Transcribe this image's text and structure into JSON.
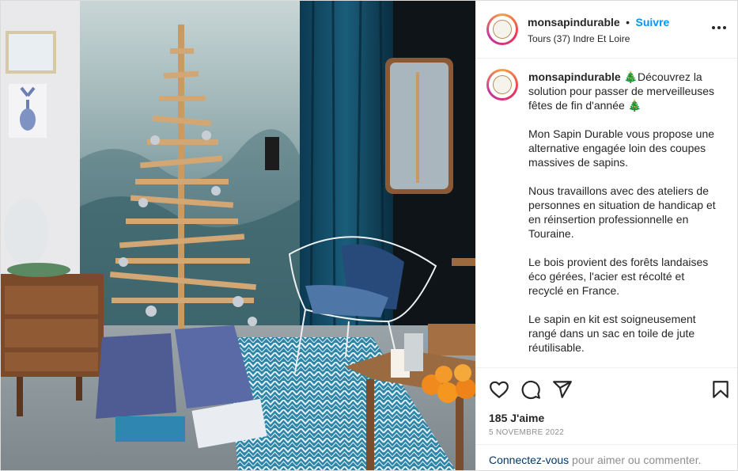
{
  "post": {
    "username": "monsapindurable",
    "separator": "•",
    "follow_label": "Suivre",
    "location": "Tours (37) Indre Et Loire",
    "more_label": "•••",
    "avatar_logo_text": "MON SAPIN DURABLE"
  },
  "caption": {
    "username": "monsapindurable",
    "paragraphs": [
      "🎄Découvrez la solution pour passer de merveilleuses fêtes de fin d'année 🎄",
      "Mon Sapin Durable vous propose une alternative engagée loin des coupes massives de sapins.",
      "Nous travaillons avec des ateliers de personnes en situation de handicap et en réinsertion professionnelle en Touraine.",
      "Le bois provient des forêts landaises éco gérées, l'acier est récolté et recyclé en France.",
      "Le sapin en kit est soigneusement rangé dans un sac en toile de jute réutilisable."
    ]
  },
  "actions": {
    "icons": [
      "heart-icon",
      "comment-icon",
      "share-icon",
      "bookmark-icon"
    ],
    "likes": "185 J'aime",
    "date": "5 NOVEMBRE 2022"
  },
  "login": {
    "link": "Connectez-vous",
    "text": " pour aimer ou commenter."
  },
  "colors": {
    "accent": "#0095f6",
    "link": "#00376b",
    "muted": "#8e8e8e",
    "border": "#dbdbdb"
  }
}
